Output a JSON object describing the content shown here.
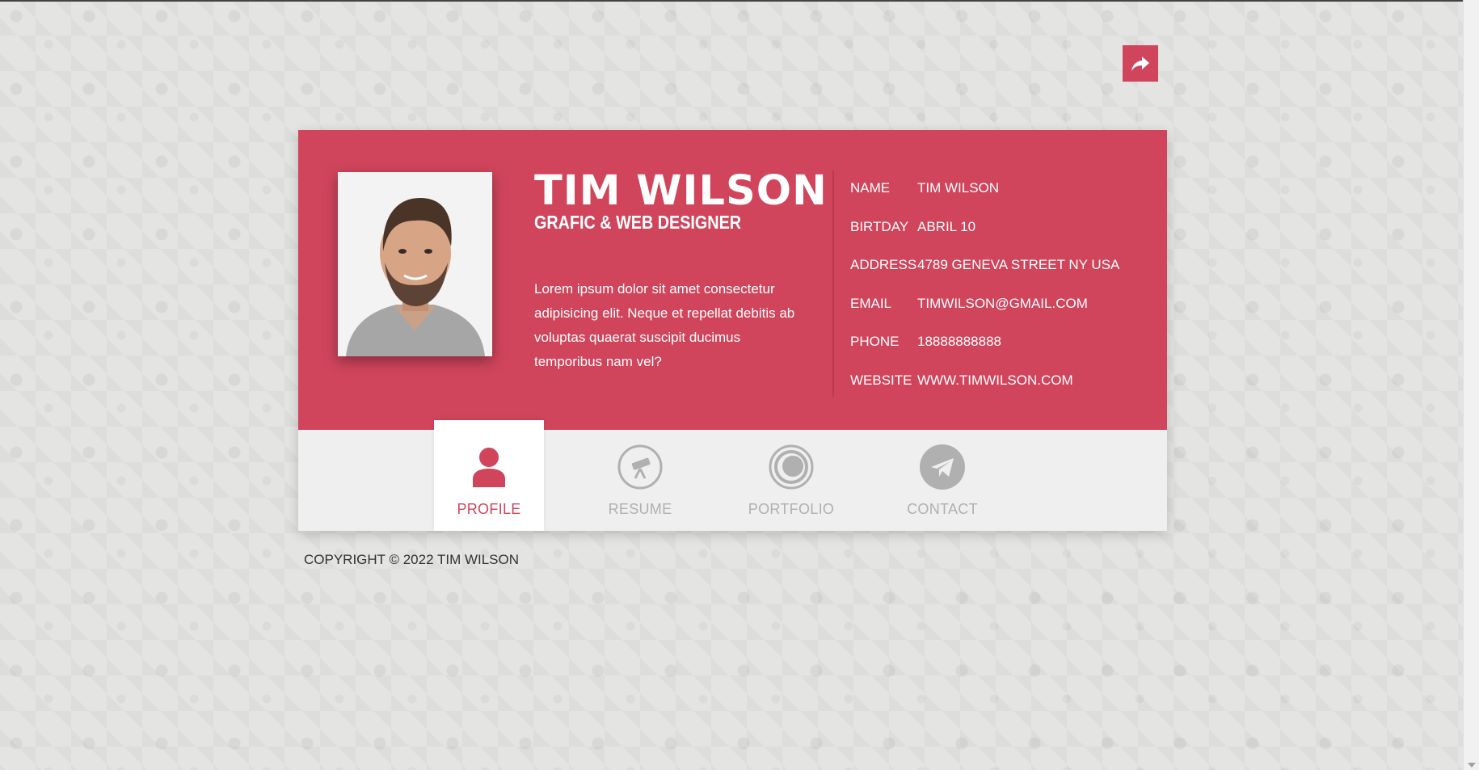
{
  "profile": {
    "name": "TIM WILSON",
    "job_title": "GRAFIC & WEB DESIGNER",
    "bio": "Lorem ipsum dolor sit amet consectetur adipisicing elit. Neque et repellat debitis ab voluptas quaerat suscipit ducimus temporibus nam vel?",
    "photo_icon": "portrait-photo"
  },
  "info": [
    {
      "label": "NAME",
      "value": "TIM WILSON"
    },
    {
      "label": "BIRTDAY",
      "value": "ABRIL 10"
    },
    {
      "label": "ADDRESS",
      "value": "4789 GENEVA STREET NY USA"
    },
    {
      "label": "EMAIL",
      "value": "TIMWILSON@GMAIL.COM"
    },
    {
      "label": "PHONE",
      "value": "18888888888"
    },
    {
      "label": "WEBSITE",
      "value": "WWW.TIMWILSON.COM"
    }
  ],
  "nav": {
    "tabs": [
      {
        "label": "PROFILE",
        "icon": "user-icon",
        "active": true
      },
      {
        "label": "RESUME",
        "icon": "telescope-icon",
        "active": false
      },
      {
        "label": "PORTFOLIO",
        "icon": "disc-icon",
        "active": false
      },
      {
        "label": "CONTACT",
        "icon": "paper-plane-icon",
        "active": false
      }
    ]
  },
  "share": {
    "icon": "share-arrow-icon"
  },
  "footer": {
    "copyright": "COPYRIGHT © 2022 TIM WILSON"
  },
  "colors": {
    "accent": "#d0455c",
    "nav_bg": "#efefef",
    "inactive_icon": "#b0b0b0",
    "page_bg": "#e4e4e2"
  }
}
